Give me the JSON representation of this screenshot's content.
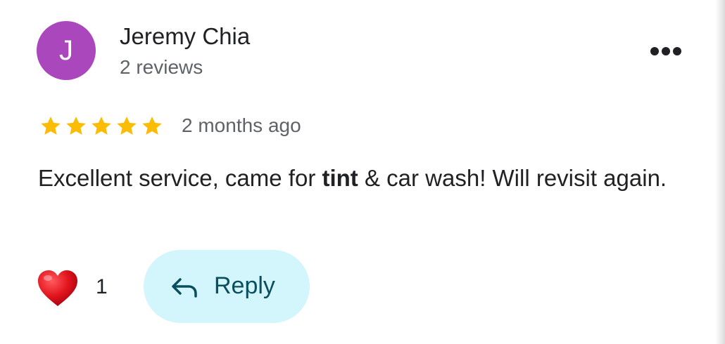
{
  "review": {
    "author": {
      "initial": "J",
      "name": "Jeremy Chia",
      "reviews_count": "2 reviews",
      "avatar_color": "#ab47bc"
    },
    "rating": 5,
    "rating_max": 5,
    "star_color": "#fbbc04",
    "time": "2 months ago",
    "text_parts": {
      "before": "Excellent service, came for ",
      "bold": "tint",
      "after": " & car wash! Will revisit again."
    },
    "likes": {
      "icon": "heart-icon",
      "count": "1"
    },
    "reply": {
      "icon": "reply-arrow-icon",
      "label": "Reply",
      "background": "#d3f5fc"
    },
    "more": {
      "icon": "more-horizontal-icon"
    }
  }
}
